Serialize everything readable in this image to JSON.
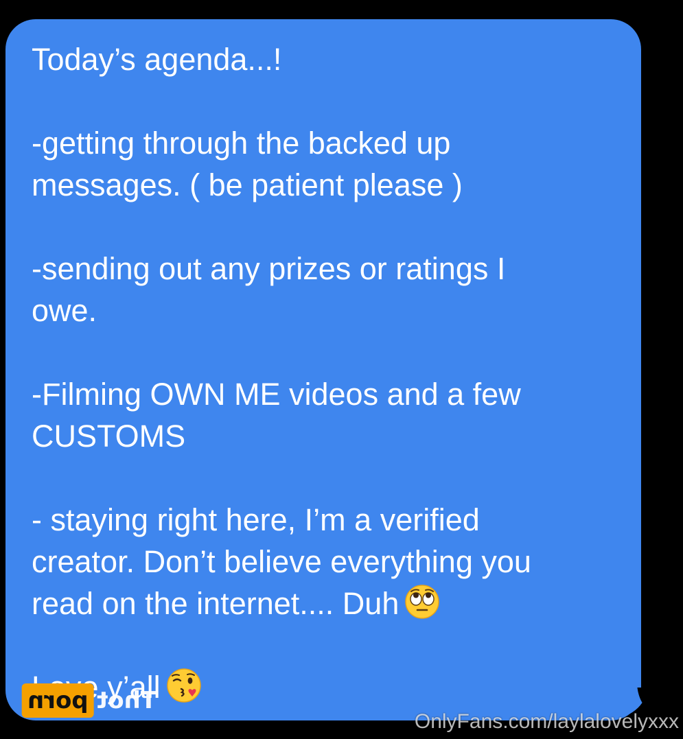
{
  "message": {
    "lines": [
      "Today’s agenda...!",
      "",
      "-getting through the backed up",
      "messages. ( be patient please )",
      "",
      "-sending out any prizes or ratings I",
      "owe.",
      "",
      "-Filming OWN ME videos and a few",
      "CUSTOMS",
      "",
      "- staying right here, I’m a verified",
      "creator. Don’t believe everything you",
      "read on the internet.... Duh",
      "",
      "Love y’all"
    ],
    "emoji_1": "face-with-rolling-eyes-icon",
    "emoji_2": "face-blowing-a-kiss-icon"
  },
  "watermarks": {
    "logo_box": "porn",
    "logo_text": "Thot",
    "url": "OnlyFans.com/laylalovelyxxx"
  },
  "colors": {
    "bubble": "#3f86ee",
    "background": "#000000",
    "text": "#ffffff",
    "logo": "#f5a000"
  }
}
